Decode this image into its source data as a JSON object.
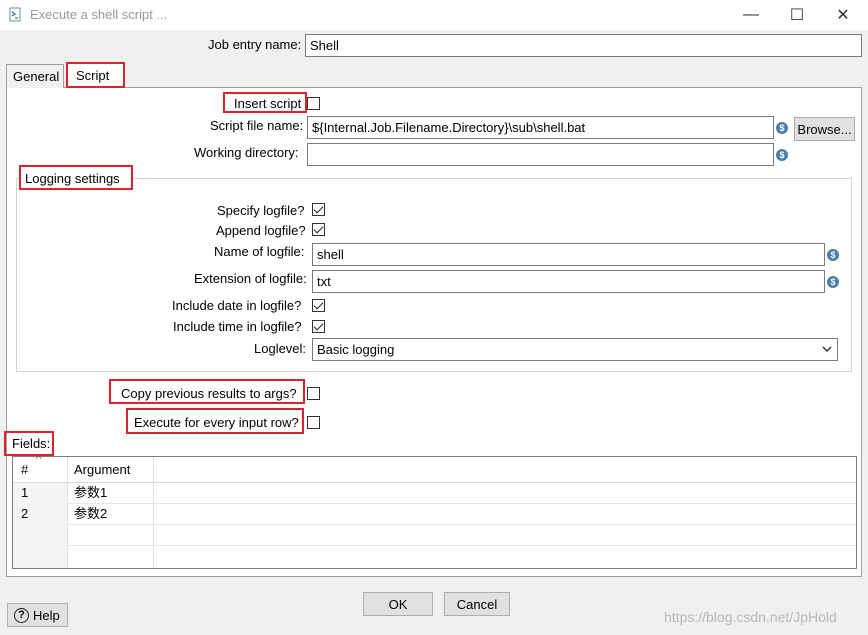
{
  "window": {
    "title": "Execute a shell script ...",
    "controls": {
      "minimize": "—",
      "maximize": "☐",
      "close": "✕"
    }
  },
  "job_entry": {
    "label": "Job entry name:",
    "value": "Shell"
  },
  "tabs": [
    {
      "label": "General",
      "active": false
    },
    {
      "label": "Script",
      "active": true
    }
  ],
  "script": {
    "insert_script_label": "Insert script",
    "insert_script_checked": false,
    "script_file_label": "Script file name:",
    "script_file_value": "${Internal.Job.Filename.Directory}\\sub\\shell.bat",
    "browse_label": "Browse...",
    "working_dir_label": "Working directory:",
    "working_dir_value": ""
  },
  "logging": {
    "group_label": "Logging settings",
    "specify_label": "Specify logfile?",
    "specify_checked": true,
    "append_label": "Append logfile?",
    "append_checked": true,
    "name_label": "Name of logfile:",
    "name_value": "shell",
    "ext_label": "Extension of logfile:",
    "ext_value": "txt",
    "date_label": "Include date in logfile?",
    "date_checked": true,
    "time_label": "Include time in logfile?",
    "time_checked": true,
    "loglevel_label": "Loglevel:",
    "loglevel_value": "Basic logging"
  },
  "options": {
    "copy_prev_label": "Copy previous results to args?",
    "copy_prev_checked": false,
    "every_row_label": "Execute for every input row?",
    "every_row_checked": false
  },
  "fields": {
    "label": "Fields:",
    "sort_glyph": "^",
    "columns": [
      "#",
      "Argument"
    ],
    "rows": [
      {
        "num": "1",
        "argument": "参数1"
      },
      {
        "num": "2",
        "argument": "参数2"
      }
    ]
  },
  "buttons": {
    "ok": "OK",
    "cancel": "Cancel",
    "help": "Help",
    "help_icon": "?"
  },
  "variable_icon_glyph": "$",
  "watermark": "https://blog.csdn.net/JpHold",
  "colors": {
    "highlight": "#d9232e",
    "dialog_bg": "#f0f0f0",
    "variable_icon": "#4a7fa8"
  }
}
